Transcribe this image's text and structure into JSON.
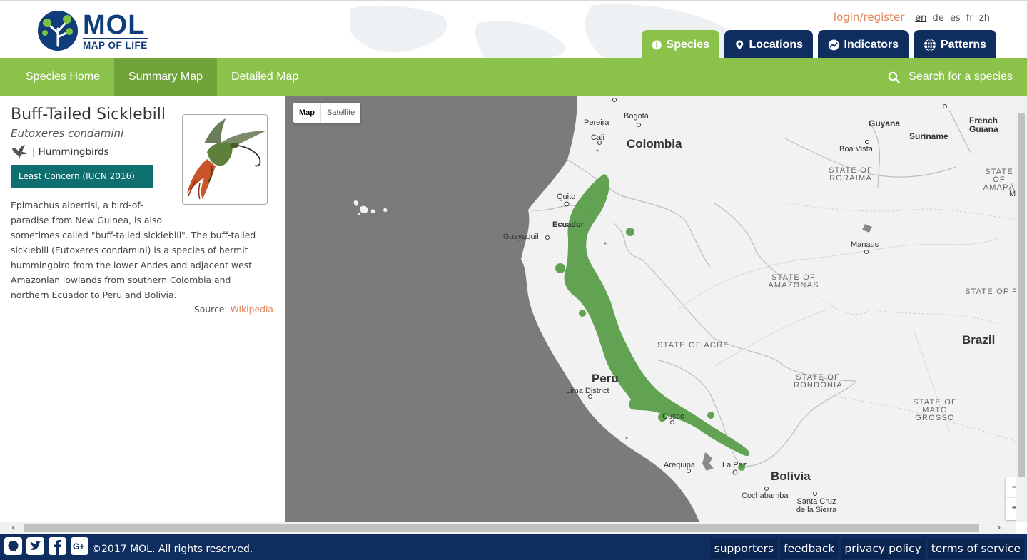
{
  "brand": {
    "name": "MOL",
    "subtitle": "MAP OF LIFE"
  },
  "auth": {
    "login_label": "login/register",
    "languages": [
      "en",
      "de",
      "es",
      "fr",
      "zh"
    ],
    "active_language": "en"
  },
  "tabs": [
    {
      "label": "Species",
      "icon": "info-icon",
      "active": true
    },
    {
      "label": "Locations",
      "icon": "map-pin-icon",
      "active": false
    },
    {
      "label": "Indicators",
      "icon": "trend-chart-icon",
      "active": false
    },
    {
      "label": "Patterns",
      "icon": "globe-icon",
      "active": false
    }
  ],
  "subnav": {
    "items": [
      {
        "label": "Species Home",
        "active": false
      },
      {
        "label": "Summary Map",
        "active": true
      },
      {
        "label": "Detailed Map",
        "active": false
      }
    ],
    "search_placeholder": "Search for a species"
  },
  "species": {
    "common_name": "Buff-Tailed Sicklebill",
    "scientific_name": "Eutoxeres condamini",
    "group_icon": "bird-silhouette-icon",
    "group": "Hummingbirds",
    "status": "Least Concern (IUCN 2016)",
    "description_1": "Epimachus albertisi, a bird-of-paradise from New Guinea, is also",
    "description_2": "sometimes called \"buff-tailed sicklebill\". The buff-tailed sicklebill (Eutoxeres condamini) is a species of hermit hummingbird from the lower Andes and adjacent west Amazonian lowlands from southern Colombia and northern Ecuador to Peru and Bolivia.",
    "source_label": "Source:",
    "source_link": "Wikipedia"
  },
  "map": {
    "type_options": [
      "Map",
      "Satellite"
    ],
    "active_type": "Map",
    "range_color": "#5a9e4a",
    "labels": {
      "pereira": "Pereira",
      "bogota": "Bogotá",
      "cali": "Cali",
      "colombia": "Colombia",
      "guyana": "Guyana",
      "suriname": "Suriname",
      "french_guiana": "French Guiana",
      "boa_vista": "Boa Vista",
      "roraima": "STATE OF RORAIMA",
      "amapa": "STATE OF AMAPÁ",
      "macapa": "Maca",
      "quito": "Quito",
      "ecuador": "Ecuador",
      "guayaquil": "Guayaquil",
      "manaus": "Manaus",
      "amazonas": "STATE OF AMAZONAS",
      "para": "STATE OF PAR",
      "brazil": "Brazil",
      "acre": "STATE OF ACRE",
      "peru": "Peru",
      "lima": "Lima District",
      "rondonia": "STATE OF RONDÔNIA",
      "mato_grosso": "STATE OF MATO GROSSO",
      "cusco": "Cusco",
      "arequipa": "Arequipa",
      "la_paz": "La Paz",
      "bolivia": "Bolivia",
      "cochabamba": "Cochabamba",
      "santa_cruz": "Santa Cruz de la Sierra"
    },
    "zoom_in": "+",
    "zoom_out": "−"
  },
  "footer": {
    "social": [
      "github-icon",
      "twitter-icon",
      "facebook-icon",
      "google-plus-icon"
    ],
    "copyright": "©2017 MOL. All rights reserved.",
    "links": [
      "supporters",
      "feedback",
      "privacy policy",
      "terms of service"
    ]
  }
}
